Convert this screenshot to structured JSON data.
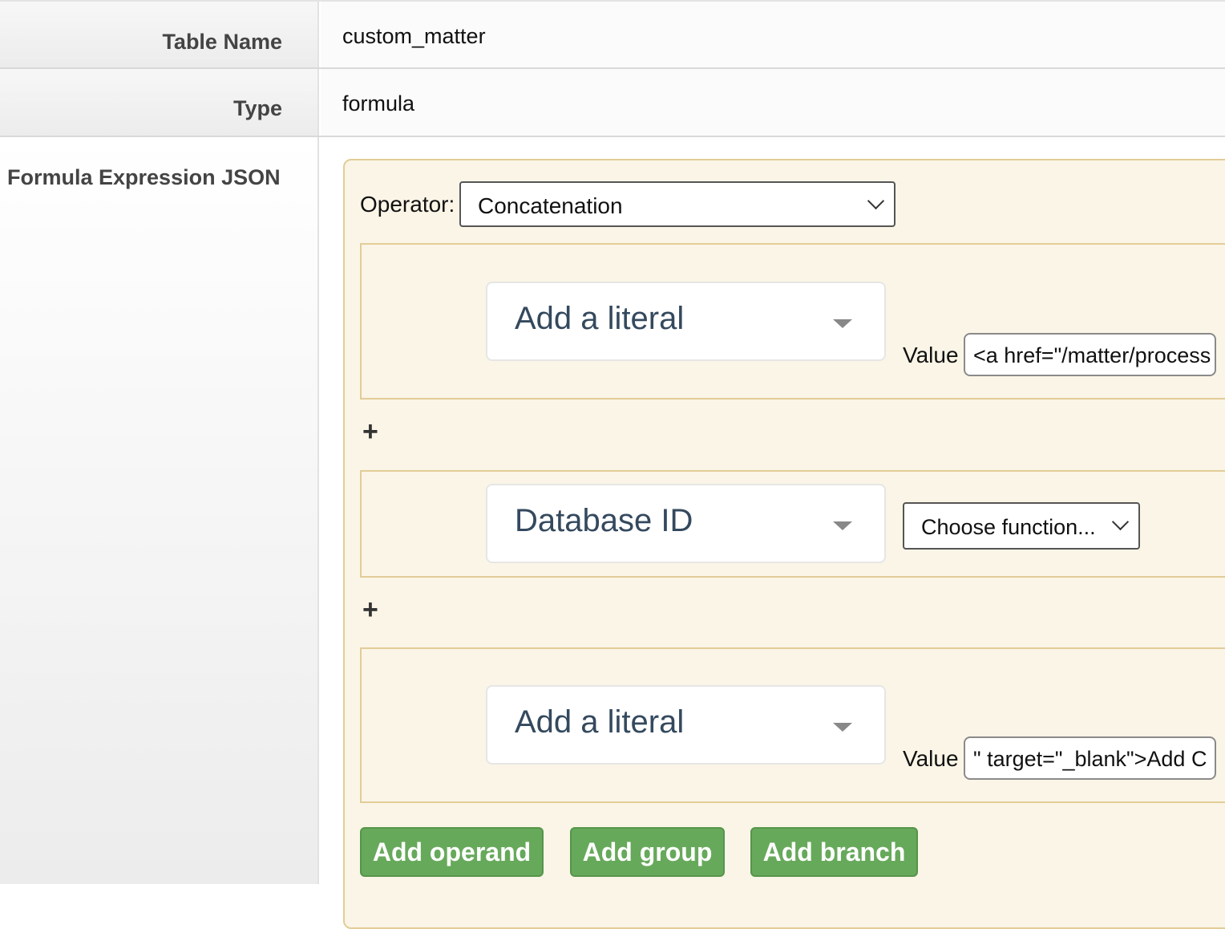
{
  "table_name": {
    "label": "Table Name",
    "value": "custom_matter"
  },
  "type": {
    "label": "Type",
    "value": "formula"
  },
  "formula": {
    "label": "Formula Expression JSON",
    "operator_label": "Operator:",
    "operator_value": "Concatenation",
    "operands": [
      {
        "selector": "Add a literal",
        "value_label": "Value",
        "value": "<a href=\"/matter/process"
      },
      {
        "selector": "Database ID",
        "function": "Choose function..."
      },
      {
        "selector": "Add a literal",
        "value_label": "Value",
        "value": "\" target=\"_blank\">Add C"
      }
    ],
    "plus_symbol": "+",
    "buttons": {
      "add_operand": "Add operand",
      "add_group": "Add group",
      "add_branch": "Add branch"
    }
  },
  "colors": {
    "panel_bg": "#faf5e6",
    "panel_border": "#e3cc98",
    "button_green": "#67a95b",
    "select_text": "#34495e"
  }
}
